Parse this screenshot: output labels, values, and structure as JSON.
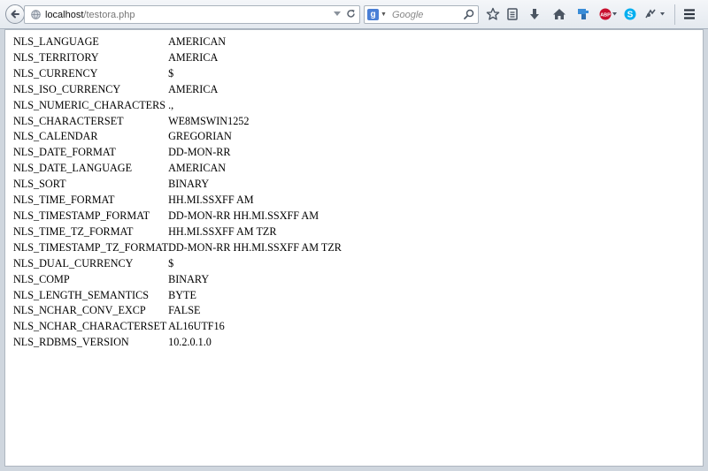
{
  "browser": {
    "url_host": "localhost",
    "url_path": "/testora.php",
    "search_placeholder": "Google",
    "search_engine_letter": "g",
    "toolbar_icons": [
      "bookmark-star-icon",
      "reading-list-icon",
      "download-icon",
      "home-icon",
      "extension-icon",
      "adblock-icon",
      "skype-icon",
      "plugin-icon",
      "menu-icon"
    ]
  },
  "parameters": [
    {
      "name": "NLS_LANGUAGE",
      "value": "AMERICAN"
    },
    {
      "name": "NLS_TERRITORY",
      "value": "AMERICA"
    },
    {
      "name": "NLS_CURRENCY",
      "value": "$"
    },
    {
      "name": "NLS_ISO_CURRENCY",
      "value": "AMERICA"
    },
    {
      "name": "NLS_NUMERIC_CHARACTERS",
      "value": ".,"
    },
    {
      "name": "NLS_CHARACTERSET",
      "value": "WE8MSWIN1252"
    },
    {
      "name": "NLS_CALENDAR",
      "value": "GREGORIAN"
    },
    {
      "name": "NLS_DATE_FORMAT",
      "value": "DD-MON-RR"
    },
    {
      "name": "NLS_DATE_LANGUAGE",
      "value": "AMERICAN"
    },
    {
      "name": "NLS_SORT",
      "value": "BINARY"
    },
    {
      "name": "NLS_TIME_FORMAT",
      "value": "HH.MI.SSXFF AM"
    },
    {
      "name": "NLS_TIMESTAMP_FORMAT",
      "value": "DD-MON-RR HH.MI.SSXFF AM"
    },
    {
      "name": "NLS_TIME_TZ_FORMAT",
      "value": "HH.MI.SSXFF AM TZR"
    },
    {
      "name": "NLS_TIMESTAMP_TZ_FORMAT",
      "value": "DD-MON-RR HH.MI.SSXFF AM TZR"
    },
    {
      "name": "NLS_DUAL_CURRENCY",
      "value": "$"
    },
    {
      "name": "NLS_COMP",
      "value": "BINARY"
    },
    {
      "name": "NLS_LENGTH_SEMANTICS",
      "value": "BYTE"
    },
    {
      "name": "NLS_NCHAR_CONV_EXCP",
      "value": "FALSE"
    },
    {
      "name": "NLS_NCHAR_CHARACTERSET",
      "value": "AL16UTF16"
    },
    {
      "name": "NLS_RDBMS_VERSION",
      "value": "10.2.0.1.0"
    }
  ]
}
